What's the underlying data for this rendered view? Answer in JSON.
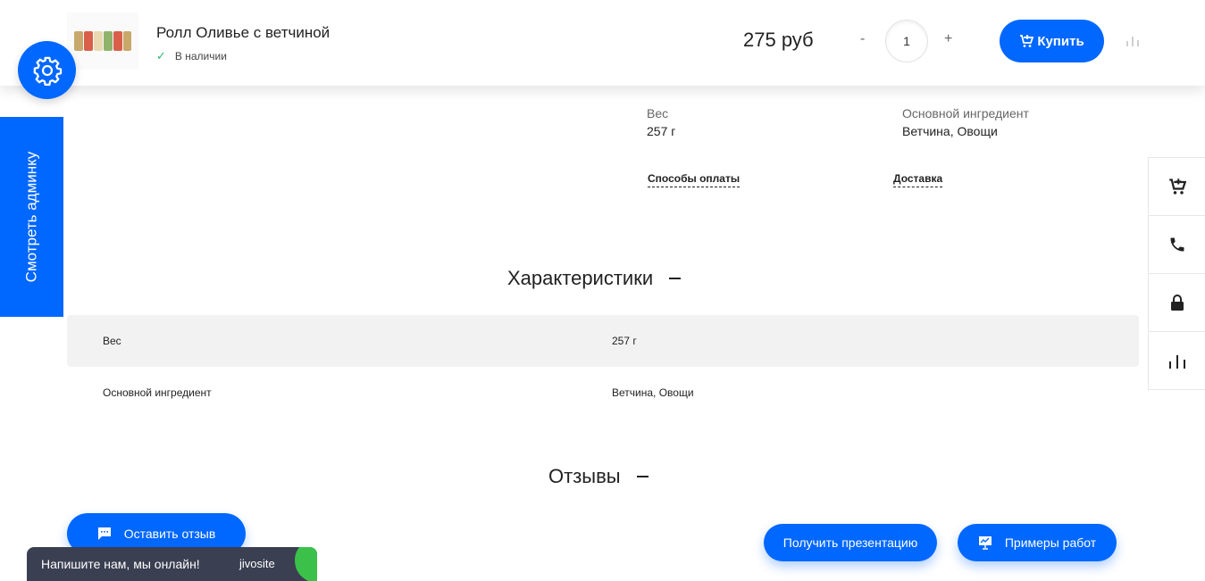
{
  "product": {
    "title": "Ролл Оливье с ветчиной",
    "stock": "В наличии",
    "price": "275 руб",
    "qty_minus": "-",
    "qty": "1",
    "qty_plus": "+",
    "buy_label": "Купить"
  },
  "admin_tab": {
    "label": "Смотреть админку"
  },
  "properties": {
    "weight_label": "Вес",
    "weight_value": "257 г",
    "ingredient_label": "Основной ингредиент",
    "ingredient_value": "Ветчина, Овощи",
    "payment_link": "Способы оплаты",
    "delivery_link": "Доставка"
  },
  "characteristics": {
    "title": "Характеристики",
    "rows": [
      {
        "name": "Вес",
        "value": "257 г"
      },
      {
        "name": "Основной ингредиент",
        "value": "Ветчина, Овощи"
      }
    ]
  },
  "reviews": {
    "title": "Отзывы",
    "leave_review": "Оставить отзыв"
  },
  "actions": {
    "presentation": "Получить презентацию",
    "examples": "Примеры работ"
  },
  "chat": {
    "text": "Напишите нам, мы онлайн!",
    "brand": "jivosite"
  },
  "colors": {
    "accent": "#0067ff",
    "success": "#2bb673",
    "chat_bg": "#3a3f51",
    "chat_accent": "#3bc14a"
  },
  "icons": {
    "settings": "gear-icon",
    "cart": "cart-icon",
    "phone": "phone-icon",
    "lock": "lock-icon",
    "stats": "bar-chart-icon",
    "comment": "comment-icon",
    "presentation": "presentation-icon",
    "stock": "check-icon"
  }
}
